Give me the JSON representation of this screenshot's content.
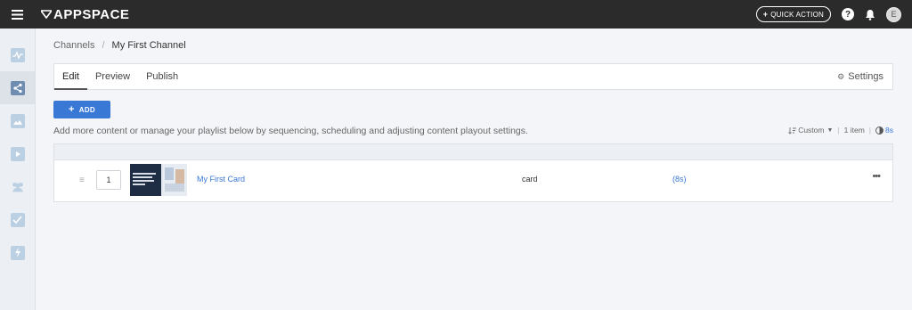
{
  "header": {
    "brand": "APPSPACE",
    "quick_action_label": "QUICK ACTION",
    "avatar_initial": "E"
  },
  "sidebar": {
    "items": [
      {
        "name": "dashboard",
        "icon": "activity-icon",
        "active": false
      },
      {
        "name": "channels",
        "icon": "share-icon",
        "active": true
      },
      {
        "name": "library",
        "icon": "image-icon",
        "active": false
      },
      {
        "name": "playlists",
        "icon": "play-icon",
        "active": false
      },
      {
        "name": "users",
        "icon": "users-icon",
        "active": false
      },
      {
        "name": "approvals",
        "icon": "check-icon",
        "active": false
      },
      {
        "name": "extensions",
        "icon": "lightning-icon",
        "active": false
      }
    ]
  },
  "breadcrumb": {
    "parent": "Channels",
    "separator": "/",
    "current": "My First Channel"
  },
  "tabs": {
    "edit": "Edit",
    "preview": "Preview",
    "publish": "Publish",
    "settings": "Settings"
  },
  "toolbar": {
    "add_label": "ADD",
    "hint": "Add more content or manage your playlist below by sequencing, scheduling and adjusting content playout settings.",
    "sort_label": "Custom",
    "item_count": "1 item",
    "total_duration": "8s"
  },
  "playlist": {
    "rows": [
      {
        "order": "1",
        "name": "My First Card",
        "type": "card",
        "duration": "(8s)",
        "menu": "•••"
      }
    ]
  },
  "colors": {
    "topbar": "#2b2b2b",
    "accent": "#3a78d6",
    "sidebar": "#eceff3"
  }
}
